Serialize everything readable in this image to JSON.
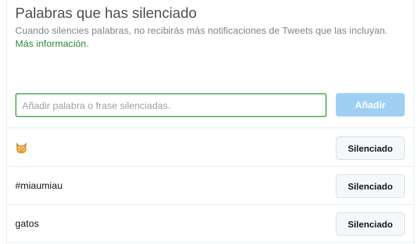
{
  "header": {
    "title": "Palabras que has silenciado",
    "description": "Cuando silencies palabras, no recibirás más notificaciones de Tweets que las incluyan.",
    "more_link": "Más información",
    "more_link_suffix": "."
  },
  "form": {
    "placeholder": "Añadir palabra o frase silenciadas.",
    "value": "",
    "add_label": "Añadir"
  },
  "muted": [
    {
      "icon": "cat-face-emoji-icon",
      "label": "",
      "button": "Silenciado"
    },
    {
      "label": "#miaumiau",
      "button": "Silenciado"
    },
    {
      "label": "gatos",
      "button": "Silenciado"
    }
  ],
  "colors": {
    "link": "#2f8a3a",
    "input_border": "#69b76d",
    "add_button_disabled": "#9fd0f4"
  }
}
